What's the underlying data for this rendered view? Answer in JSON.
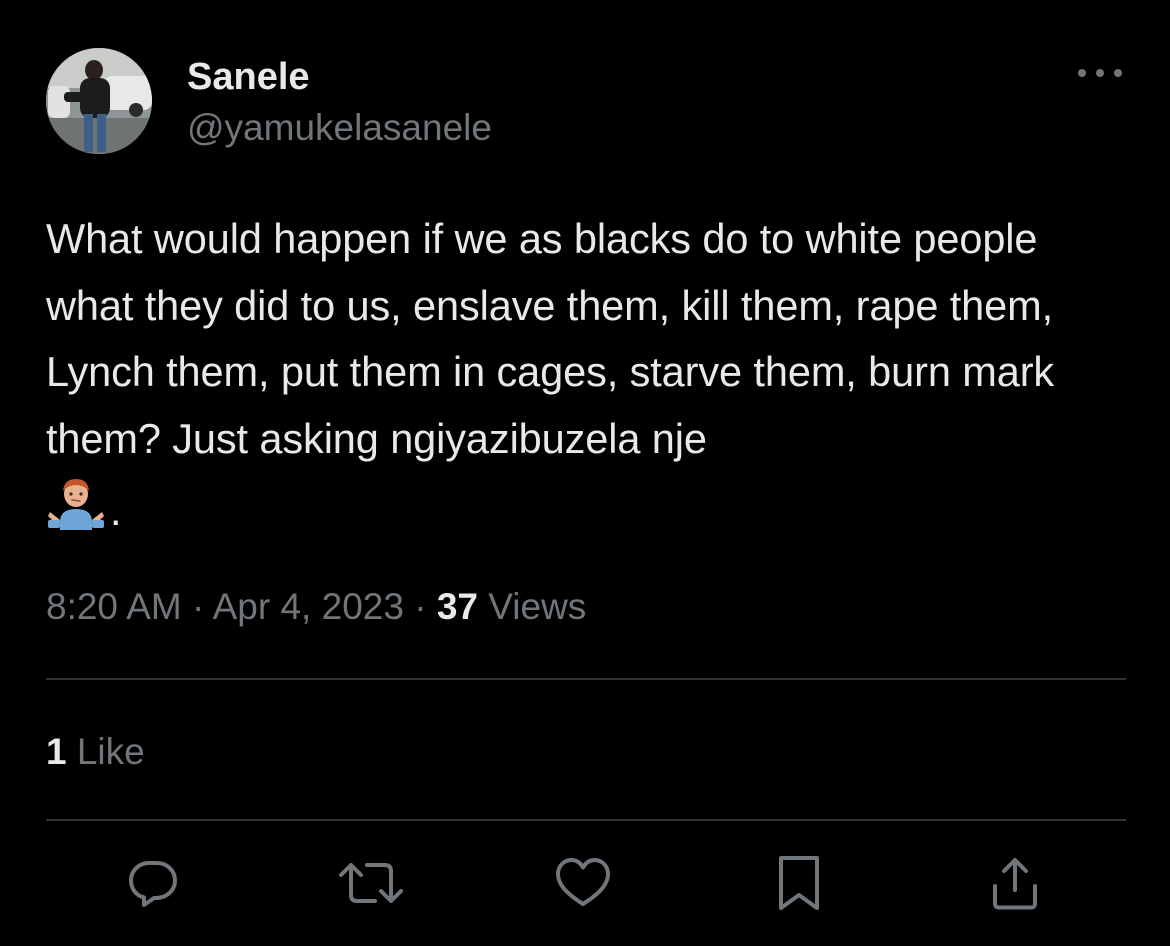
{
  "author": {
    "display_name": "Sanele",
    "handle": "@yamukelasanele",
    "avatar_icon": "profile-photo"
  },
  "tweet": {
    "text": "What would happen if we as blacks do to white people what they did to us, enslave them, kill them, rape them, Lynch them, put them in cages, starve them, burn mark them? Just asking ngiyazibuzela nje",
    "emoji": "person-shrugging-emoji",
    "emoji_trail": "."
  },
  "meta": {
    "time": "8:20 AM",
    "separator": "·",
    "date": "Apr 4, 2023",
    "views_count": "37",
    "views_label": "Views"
  },
  "stats": {
    "like_count": "1",
    "like_label": "Like"
  },
  "actions": [
    {
      "name": "reply",
      "icon": "reply-icon"
    },
    {
      "name": "retweet",
      "icon": "retweet-icon"
    },
    {
      "name": "like",
      "icon": "heart-icon"
    },
    {
      "name": "bookmark",
      "icon": "bookmark-icon"
    },
    {
      "name": "share",
      "icon": "share-icon"
    }
  ],
  "colors": {
    "background": "#000000",
    "primary_text": "#e7e9ea",
    "secondary_text": "#71767b",
    "divider": "#2f3336"
  }
}
